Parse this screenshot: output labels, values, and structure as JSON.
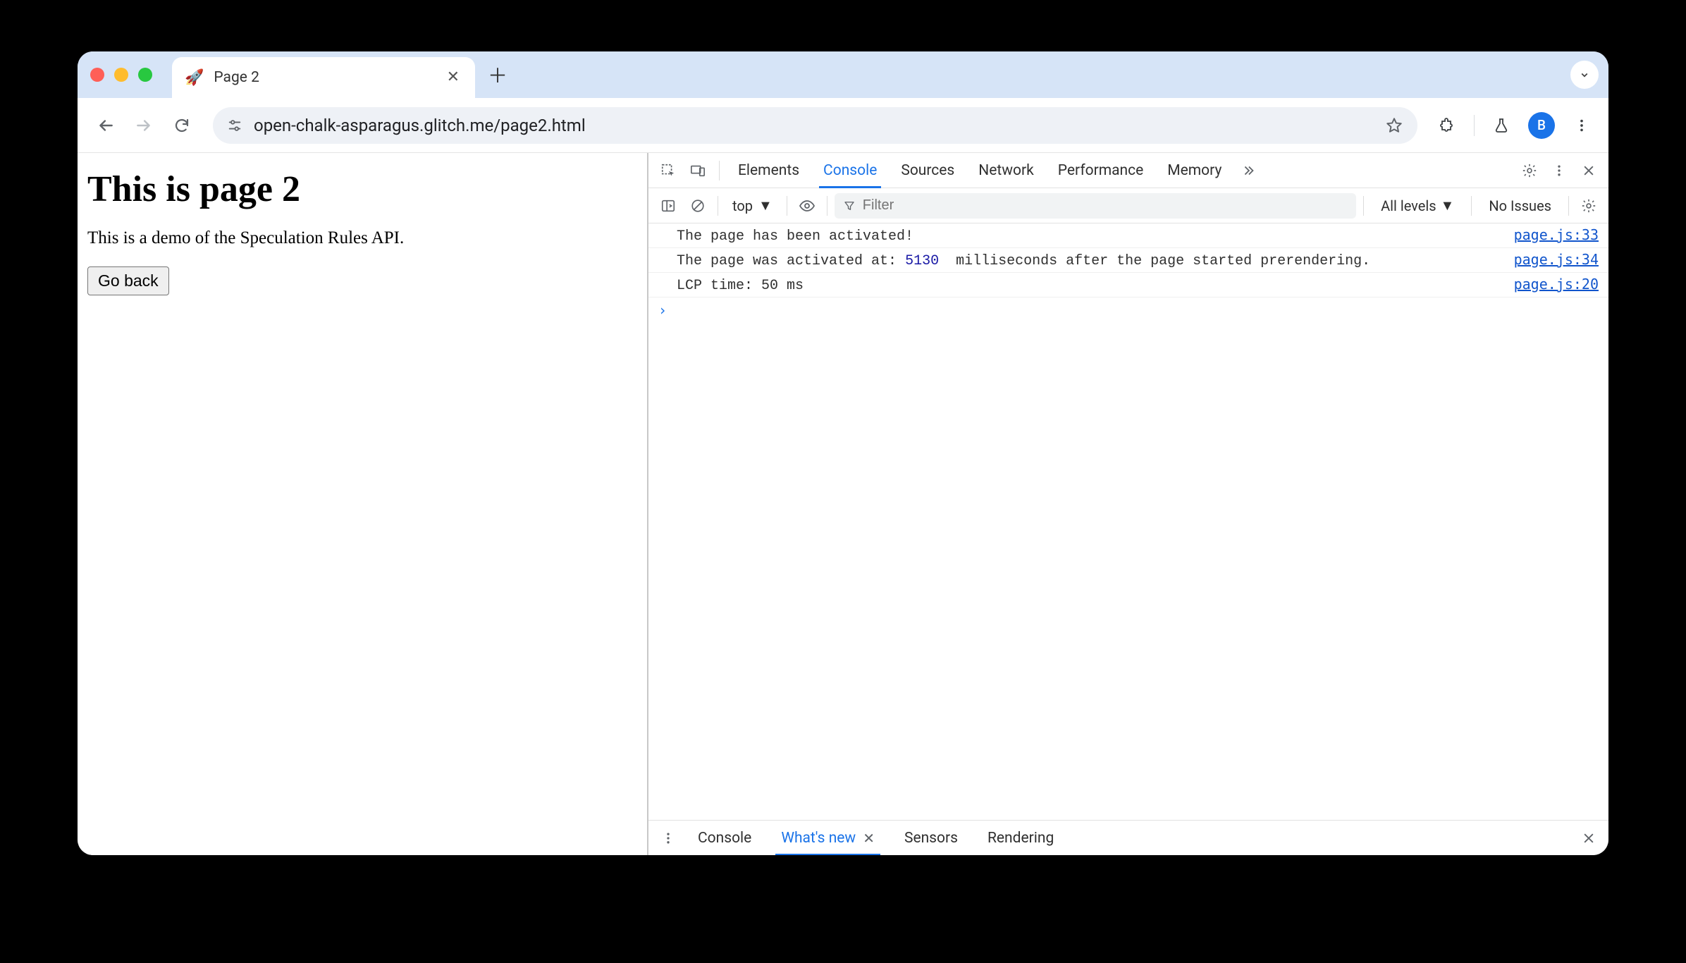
{
  "browser": {
    "tab": {
      "title": "Page 2",
      "favicon": "🚀"
    },
    "url": "open-chalk-asparagus.glitch.me/page2.html",
    "avatar_initial": "B"
  },
  "page": {
    "heading": "This is page 2",
    "paragraph": "This is a demo of the Speculation Rules API.",
    "button_label": "Go back"
  },
  "devtools": {
    "tabs": [
      "Elements",
      "Console",
      "Sources",
      "Network",
      "Performance",
      "Memory"
    ],
    "active_tab": "Console",
    "toolbar": {
      "context": "top",
      "filter_placeholder": "Filter",
      "levels_label": "All levels",
      "issues_label": "No Issues"
    },
    "console": [
      {
        "text_parts": [
          "The page has been activated!"
        ],
        "source": "page.js:33"
      },
      {
        "text_parts": [
          "The page was activated at: ",
          {
            "num": "5130"
          },
          "  milliseconds after the page started prerendering."
        ],
        "source": "page.js:34"
      },
      {
        "text_parts": [
          "LCP time: 50 ms"
        ],
        "source": "page.js:20"
      }
    ],
    "drawer_tabs": [
      "Console",
      "What's new",
      "Sensors",
      "Rendering"
    ],
    "drawer_active": "What's new"
  }
}
